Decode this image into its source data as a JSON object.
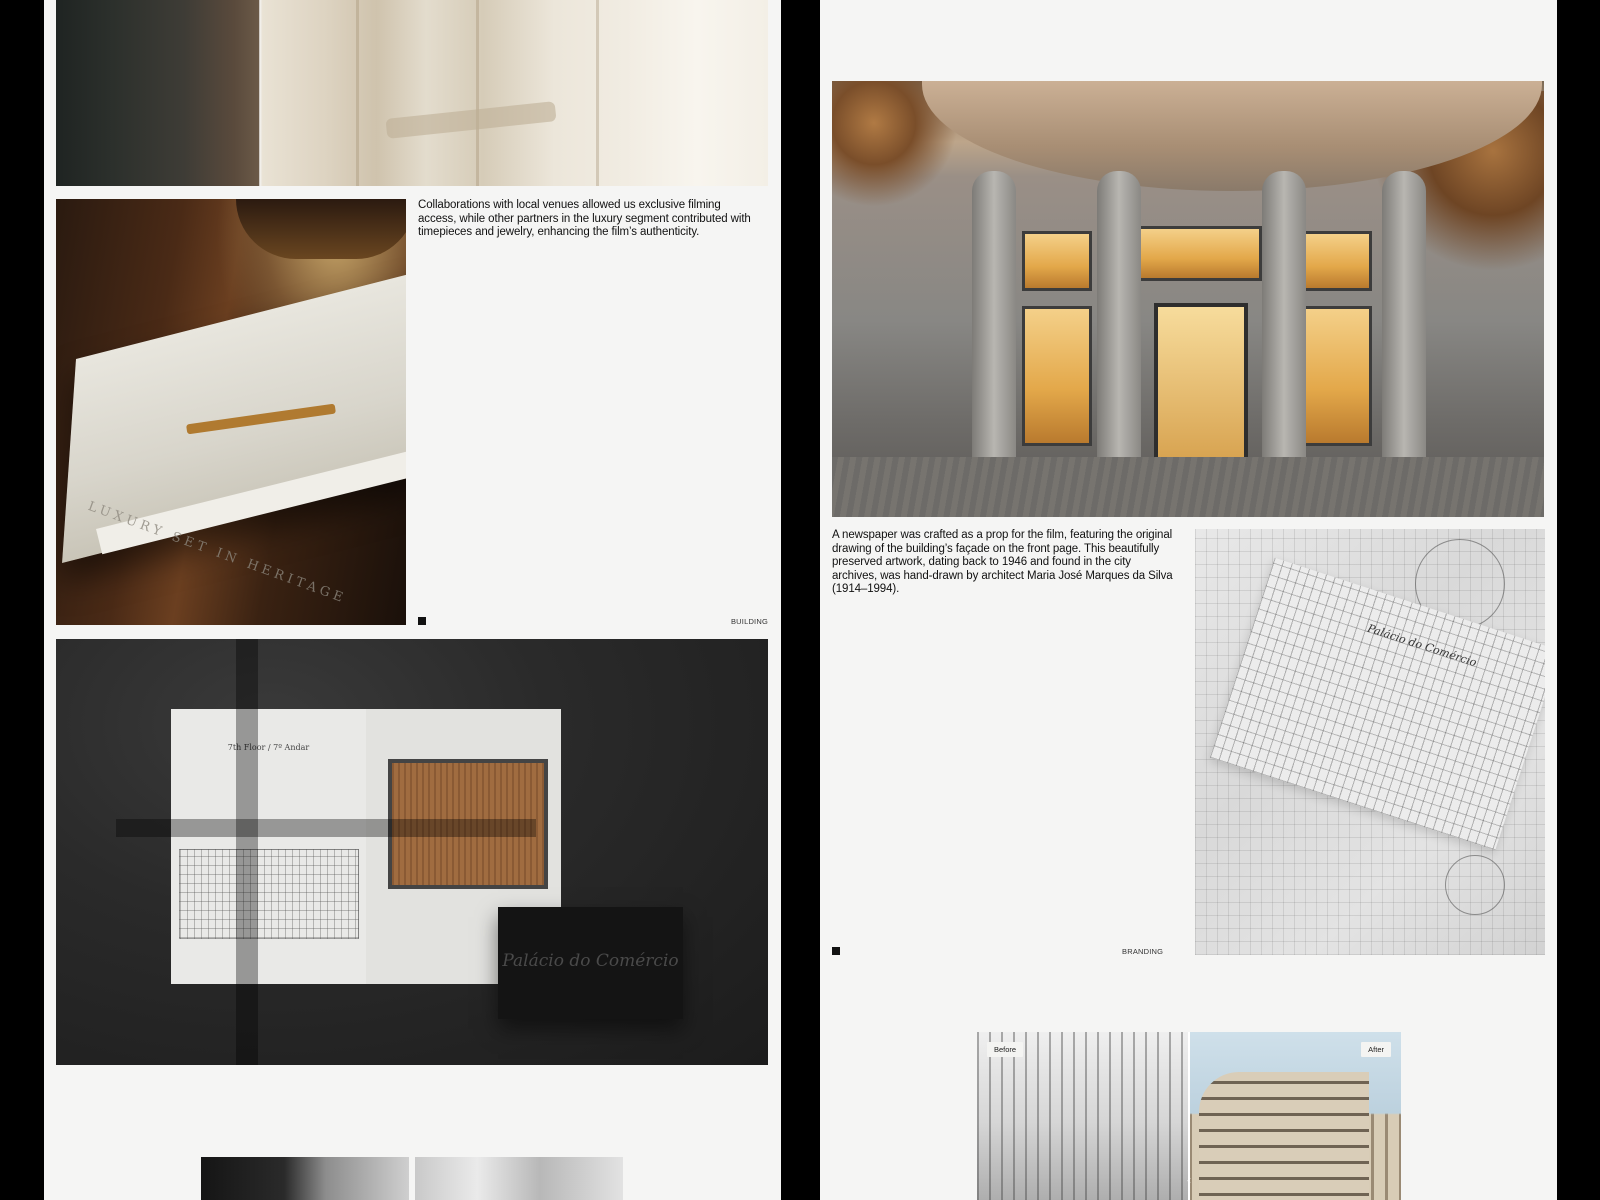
{
  "left_panel": {
    "caption": "Collaborations with local venues allowed us exclusive filming access, while other partners in the luxury segment contributed with timepieces and jewelry, enhancing the film’s authenticity.",
    "section_tag": "BUILDING",
    "brochure": {
      "floor_label": "7th Floor / 7º Andar",
      "card_logo": "Palácio do Comércio"
    },
    "book_title": "LUXURY SET IN HERITAGE"
  },
  "right_panel": {
    "caption": "A newspaper was crafted as a prop for the film, featuring the original drawing of the building’s façade on the front page. This beautifully preserved artwork, dating back to 1946 and found in the city archives, was hand-drawn by architect Maria José Marques da Silva (1914–1994).",
    "section_tag": "BRANDING",
    "blueprint_title": "Palácio do Comércio",
    "compare": {
      "before_label": "Before",
      "after_label": "After"
    }
  },
  "colors": {
    "panel_bg": "#f5f5f4",
    "gutter": "#000000",
    "text": "#111111"
  },
  "icons": {
    "section_marker": "black-square-icon",
    "compare_handle": "chevron-icon"
  }
}
